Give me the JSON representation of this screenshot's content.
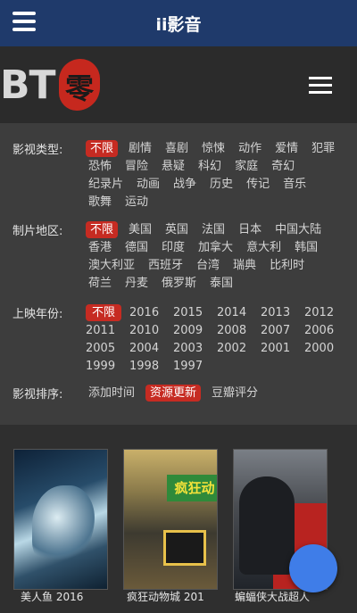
{
  "appbar": {
    "title": "ii影音",
    "menu_icon": "menu-icon"
  },
  "site": {
    "logo_text": "BT",
    "logo_glyph": "零",
    "nav_icon": "hamburger-icon"
  },
  "filters": {
    "genre": {
      "label": "影视类型:",
      "options": [
        "不限",
        "剧情",
        "喜剧",
        "惊悚",
        "动作",
        "爱情",
        "犯罪",
        "恐怖",
        "冒险",
        "悬疑",
        "科幻",
        "家庭",
        "奇幻",
        "纪录片",
        "动画",
        "战争",
        "历史",
        "传记",
        "音乐",
        "歌舞",
        "运动"
      ],
      "selected": "不限"
    },
    "region": {
      "label": "制片地区:",
      "options": [
        "不限",
        "美国",
        "英国",
        "法国",
        "日本",
        "中国大陆",
        "香港",
        "德国",
        "印度",
        "加拿大",
        "意大利",
        "韩国",
        "澳大利亚",
        "西班牙",
        "台湾",
        "瑞典",
        "比利时",
        "荷兰",
        "丹麦",
        "俄罗斯",
        "泰国"
      ],
      "selected": "不限"
    },
    "year": {
      "label": "上映年份:",
      "options": [
        "不限",
        "2016",
        "2015",
        "2014",
        "2013",
        "2012",
        "2011",
        "2010",
        "2009",
        "2008",
        "2007",
        "2006",
        "2005",
        "2004",
        "2003",
        "2002",
        "2001",
        "2000",
        "1999",
        "1998",
        "1997"
      ],
      "selected": "不限"
    },
    "sort": {
      "label": "影视排序:",
      "options": [
        "添加时间",
        "资源更新",
        "豆瓣评分"
      ],
      "selected": "资源更新"
    }
  },
  "posters": [
    {
      "caption": "美人鱼 2016"
    },
    {
      "caption": "疯狂动物城 201"
    },
    {
      "caption": "蝙蝠侠大战超人"
    }
  ],
  "poster2_sign": "疯狂动",
  "colors": {
    "appbar": "#1f3a6b",
    "accent": "#c62b22",
    "fab": "#3f7de8"
  }
}
